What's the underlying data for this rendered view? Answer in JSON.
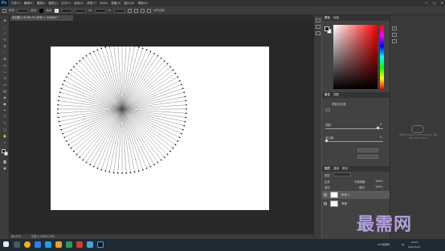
{
  "app": {
    "logo": "Ps",
    "menu": [
      "文件(F)",
      "编辑(E)",
      "图像(I)",
      "图层(L)",
      "文字(Y)",
      "选择(S)",
      "滤镜(T)",
      "3D(D)",
      "视图(V)",
      "窗口(W)",
      "帮助(H)"
    ],
    "window_controls": [
      "—",
      "□",
      "✕"
    ]
  },
  "options_bar": {
    "items": [
      "形状",
      "填充:",
      "描边:",
      "W:",
      "H:",
      "对齐边缘"
    ]
  },
  "document": {
    "tab_label": "未标题-1 @ 66.7% (形状 1, RGB/8) *",
    "zoom": "66.67%",
    "doc_info": "文档:2.25M/2.25M"
  },
  "panels": {
    "color_tabs": [
      "颜色",
      "色板"
    ],
    "adjust_tabs": [
      "属性",
      "调整"
    ],
    "adjust_labels": {
      "title": "亮度/对比度",
      "s1": "亮度:",
      "s1v": "0",
      "s2": "对比度:",
      "s2v": "0"
    },
    "layers_tabs": [
      "图层",
      "通道",
      "路径"
    ],
    "layers_filter": "类型",
    "blend_mode": "正常",
    "opacity_label": "不透明度:",
    "opacity": "100%",
    "lock_label": "锁定:",
    "fill_label": "填充:",
    "fill": "100%",
    "layers": [
      {
        "name": "形状 1",
        "selected": true
      },
      {
        "name": "背景",
        "selected": false
      }
    ]
  },
  "cc": {
    "text": "要使用 Creative Cloud Libraries，请安装 Creative Cloud"
  },
  "watermark": "最需网",
  "taskbar": {
    "tray_text": "中",
    "time": "10:15",
    "date": "2021/5/27",
    "lang": "CPU使用率"
  },
  "chart_data": {
    "type": "line",
    "title": "",
    "series": [
      {
        "name": "",
        "values": [
          96
        ]
      }
    ],
    "note": ""
  },
  "colors": {
    "accent": "#31a8ff",
    "watermark": "#b9a6e6"
  }
}
